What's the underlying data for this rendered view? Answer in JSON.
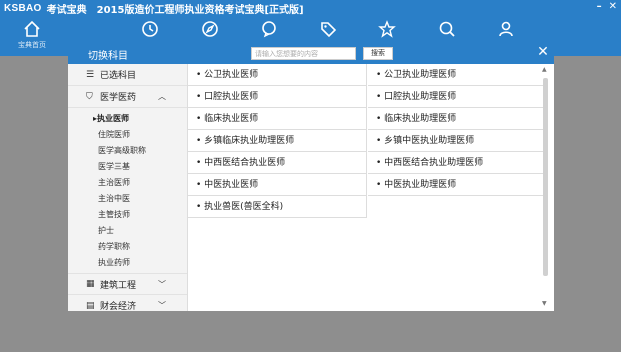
{
  "app": {
    "brand": "KSBAO",
    "brand_sub": "考试宝典",
    "title": "2015版造价工程师执业资格考试宝典[正式版]"
  },
  "toolbar": {
    "items": [
      {
        "label": "宝典首页",
        "icon": "home-icon"
      },
      {
        "label": "",
        "icon": "clock-icon"
      },
      {
        "label": "",
        "icon": "compass-icon"
      },
      {
        "label": "",
        "icon": "chat-icon"
      },
      {
        "label": "",
        "icon": "tag-icon"
      },
      {
        "label": "",
        "icon": "star-icon"
      },
      {
        "label": "",
        "icon": "search-icon"
      },
      {
        "label": "",
        "icon": "user-icon"
      }
    ]
  },
  "modal": {
    "title": "切换科目",
    "search_placeholder": "请输入您想要的内容",
    "search_button": "搜索",
    "close_label": "✕"
  },
  "sidebar": {
    "selected": {
      "label": "已选科目",
      "icon": "list-icon"
    },
    "categories": [
      {
        "label": "医学医药",
        "icon": "shield-icon",
        "expanded": true,
        "items": [
          "▸执业医师",
          "住院医师",
          "医学高级职称",
          "医学三基",
          "主治医师",
          "主治中医",
          "主管技师",
          "护士",
          "药学职称",
          "执业药师"
        ]
      },
      {
        "label": "建筑工程",
        "icon": "building-icon",
        "expanded": false
      },
      {
        "label": "财会经济",
        "icon": "ledger-icon",
        "expanded": false
      }
    ]
  },
  "subjects": {
    "left": [
      "公卫执业医师",
      "口腔执业医师",
      "临床执业医师",
      "乡镇临床执业助理医师",
      "中西医结合执业医师",
      "中医执业医师",
      "执业兽医(兽医全科)"
    ],
    "right": [
      "公卫执业助理医师",
      "口腔执业助理医师",
      "临床执业助理医师",
      "乡镇中医执业助理医师",
      "中西医结合执业助理医师",
      "中医执业助理医师"
    ]
  },
  "colors": {
    "accent": "#2a7fc8",
    "overlay": "#8e8e8e"
  }
}
